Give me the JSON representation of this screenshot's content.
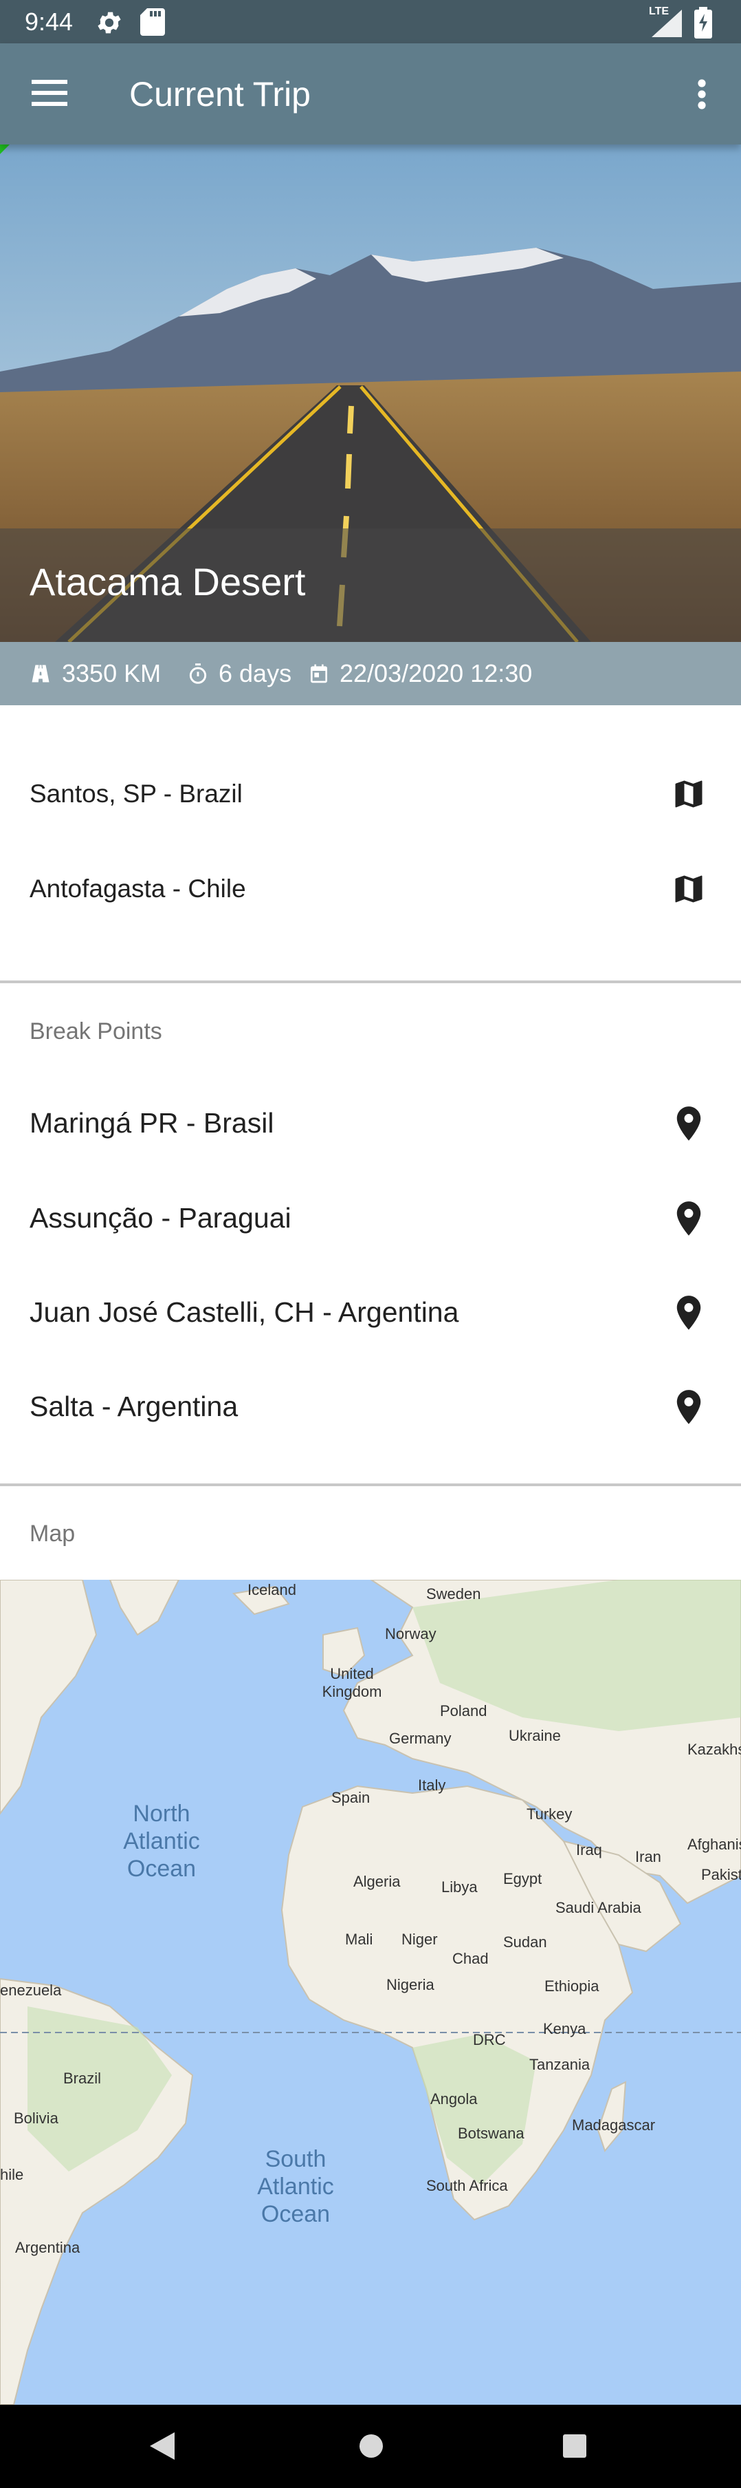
{
  "status_bar": {
    "time": "9:44",
    "network": "LTE"
  },
  "app_bar": {
    "title": "Current Trip"
  },
  "trip": {
    "title": "Atacama Desert",
    "distance": "3350 KM",
    "duration": "6 days",
    "datetime": "22/03/2020 12:30"
  },
  "route": [
    {
      "label": "Santos, SP - Brazil",
      "icon": "map-icon"
    },
    {
      "label": "Antofagasta - Chile",
      "icon": "map-icon"
    }
  ],
  "break_points": {
    "header": "Break Points",
    "items": [
      {
        "label": "Maringá PR - Brasil",
        "icon": "location-pin-icon"
      },
      {
        "label": "Assunção - Paraguai",
        "icon": "location-pin-icon"
      },
      {
        "label": "Juan José Castelli, CH - Argentina",
        "icon": "location-pin-icon"
      },
      {
        "label": "Salta - Argentina",
        "icon": "location-pin-icon"
      }
    ]
  },
  "map_section": {
    "header": "Map",
    "labels": [
      "Iceland",
      "Sweden",
      "Norway",
      "United Kingdom",
      "Poland",
      "Germany",
      "Ukraine",
      "Kazakhst",
      "Spain",
      "Italy",
      "Turkey",
      "Afghanis",
      "Iraq",
      "Iran",
      "Pakist",
      "Algeria",
      "Libya",
      "Egypt",
      "Saudi Arabia",
      "Mali",
      "Niger",
      "Chad",
      "Sudan",
      "Nigeria",
      "Ethiopia",
      "Kenya",
      "DRC",
      "Tanzania",
      "Angola",
      "Madagascar",
      "Botswana",
      "South Africa",
      "enezuela",
      "Brazil",
      "Bolivia",
      "hile",
      "Argentina"
    ],
    "oceans": [
      "North Atlantic Ocean",
      "South Atlantic Ocean"
    ]
  },
  "colors": {
    "status_bar": "#455a64",
    "app_bar": "#607d8b",
    "stats_bar": "#90a4ae",
    "ocean": "#a9cdf7",
    "land": "#f2efe6"
  }
}
